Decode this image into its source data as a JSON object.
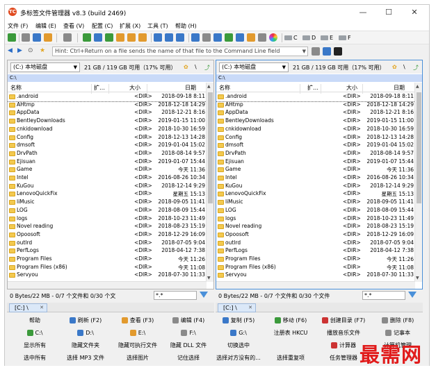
{
  "window": {
    "title": "多标签文件管理器  v8.3 (build 2469)",
    "app_icon": "TC"
  },
  "window_controls": {
    "minimize": "—",
    "maximize": "☐",
    "close": "✕"
  },
  "menu": [
    "文件 (F)",
    "编辑 (E)",
    "查看 (V)",
    "配置 (C)",
    "扩展 (X)",
    "工具 (T)",
    "帮助 (H)"
  ],
  "toolbar": {
    "drives": [
      "C",
      "D",
      "E",
      "F"
    ],
    "icons": [
      "refresh-icon",
      "cut-icon",
      "copy-icon",
      "paste-icon",
      "view-icon",
      "folder-icon",
      "copy-file-icon",
      "move-file-icon",
      "archive-icon",
      "unpack-icon",
      "search-icon",
      "find-icon",
      "sync-icon",
      "compare-icon",
      "rename-icon",
      "edit-icon",
      "color-icon"
    ],
    "colors": {
      "green": "#3b9a3b",
      "orange": "#e29a2e",
      "blue": "#3a78c8",
      "gray": "#8a8a8a"
    }
  },
  "cmdline": {
    "placeholder": "Hint: Ctrl+Return on a file sends the name of that file to the Command Line field"
  },
  "left_panel": {
    "drive": "(C:) 本地磁盘",
    "free": "21 GB / 119 GB 可用（17% 可用）",
    "path": "C:\\",
    "columns": {
      "name": "名称",
      "ext": "扩…",
      "size": "大小",
      "date": "日期"
    },
    "status": "0 Bytes/22 MB - 0/7 个文件和 0/30 个文",
    "filter": "*.*",
    "tab": "[C:] \\"
  },
  "right_panel": {
    "drive": "(C:) 本地磁盘",
    "free": "21 GB / 119 GB 可用（17% 可用）",
    "path": "C:\\",
    "columns": {
      "name": "名称",
      "ext": "扩…",
      "size": "大小",
      "date": "日期"
    },
    "status": "0 Bytes/22 MB - 0/7 个文件和 0/30 个文件",
    "filter": "*.*",
    "tab": "[C:] \\"
  },
  "files": [
    {
      "name": ".android",
      "size": "<DIR>",
      "date": "2018-09-18 8:11"
    },
    {
      "name": "AHtmp",
      "size": "<DIR>",
      "date": "2018-12-18 14:29"
    },
    {
      "name": "AppData",
      "size": "<DIR>",
      "date": "2018-12-21 8:16"
    },
    {
      "name": "BentleyDownloads",
      "size": "<DIR>",
      "date": "2019-01-15 11:00"
    },
    {
      "name": "cnkidownload",
      "size": "<DIR>",
      "date": "2018-10-30 16:59"
    },
    {
      "name": "Config",
      "size": "<DIR>",
      "date": "2018-12-13 14:28"
    },
    {
      "name": "dmsoft",
      "size": "<DIR>",
      "date": "2019-01-04 15:02"
    },
    {
      "name": "DrvPath",
      "size": "<DIR>",
      "date": "2018-08-14 9:57"
    },
    {
      "name": "Ejisuan",
      "size": "<DIR>",
      "date": "2019-01-07 15:44"
    },
    {
      "name": "Game",
      "size": "<DIR>",
      "date": "今天 11:36"
    },
    {
      "name": "Intel",
      "size": "<DIR>",
      "date": "2016-08-26 10:34"
    },
    {
      "name": "KuGou",
      "size": "<DIR>",
      "date": "2018-12-14 9:29"
    },
    {
      "name": "LenovoQuickFix",
      "size": "<DIR>",
      "date": "星期五 15:13"
    },
    {
      "name": "liMusic",
      "size": "<DIR>",
      "date": "2018-09-05 11:41"
    },
    {
      "name": "LOG",
      "size": "<DIR>",
      "date": "2018-08-09 15:44"
    },
    {
      "name": "logs",
      "size": "<DIR>",
      "date": "2018-10-23 11:49"
    },
    {
      "name": "Novel reading",
      "size": "<DIR>",
      "date": "2018-08-23 15:19"
    },
    {
      "name": "Opoosoft",
      "size": "<DIR>",
      "date": "2018-12-29 16:09"
    },
    {
      "name": "outlrd",
      "size": "<DIR>",
      "date": "2018-07-05 9:04"
    },
    {
      "name": "PerfLogs",
      "size": "<DIR>",
      "date": "2018-04-12 7:38"
    },
    {
      "name": "Program Files",
      "size": "<DIR>",
      "date": "今天 11:26"
    },
    {
      "name": "Program Files (x86)",
      "size": "<DIR>",
      "date": "今天 11:08"
    },
    {
      "name": "Servyou",
      "size": "<DIR>",
      "date": "2018-07-30 11:33"
    }
  ],
  "function_buttons": [
    [
      "帮助",
      "刷新 (F2)",
      "查看 (F3)",
      "编辑 (F4)",
      "复制 (F5)",
      "移动 (F6)",
      "创建目录 (F7)",
      "删除 (F8)"
    ],
    [
      "C:\\",
      "D:\\",
      "E:\\",
      "F:\\",
      "G:\\",
      "注册表 HKCU",
      "播放音乐文件",
      "记事本"
    ],
    [
      "显示所有",
      "隐藏文件夹",
      "隐藏可执行文件",
      "隐藏 DLL 文件",
      "切换选中",
      "",
      "计算器",
      "计算机管理"
    ],
    [
      "选中所有",
      "选择 MP3 文件",
      "选择图片",
      "记住选择",
      "选择对方没有的...",
      "选择重复项",
      "任务管理器",
      ""
    ]
  ],
  "watermark": "最需网"
}
